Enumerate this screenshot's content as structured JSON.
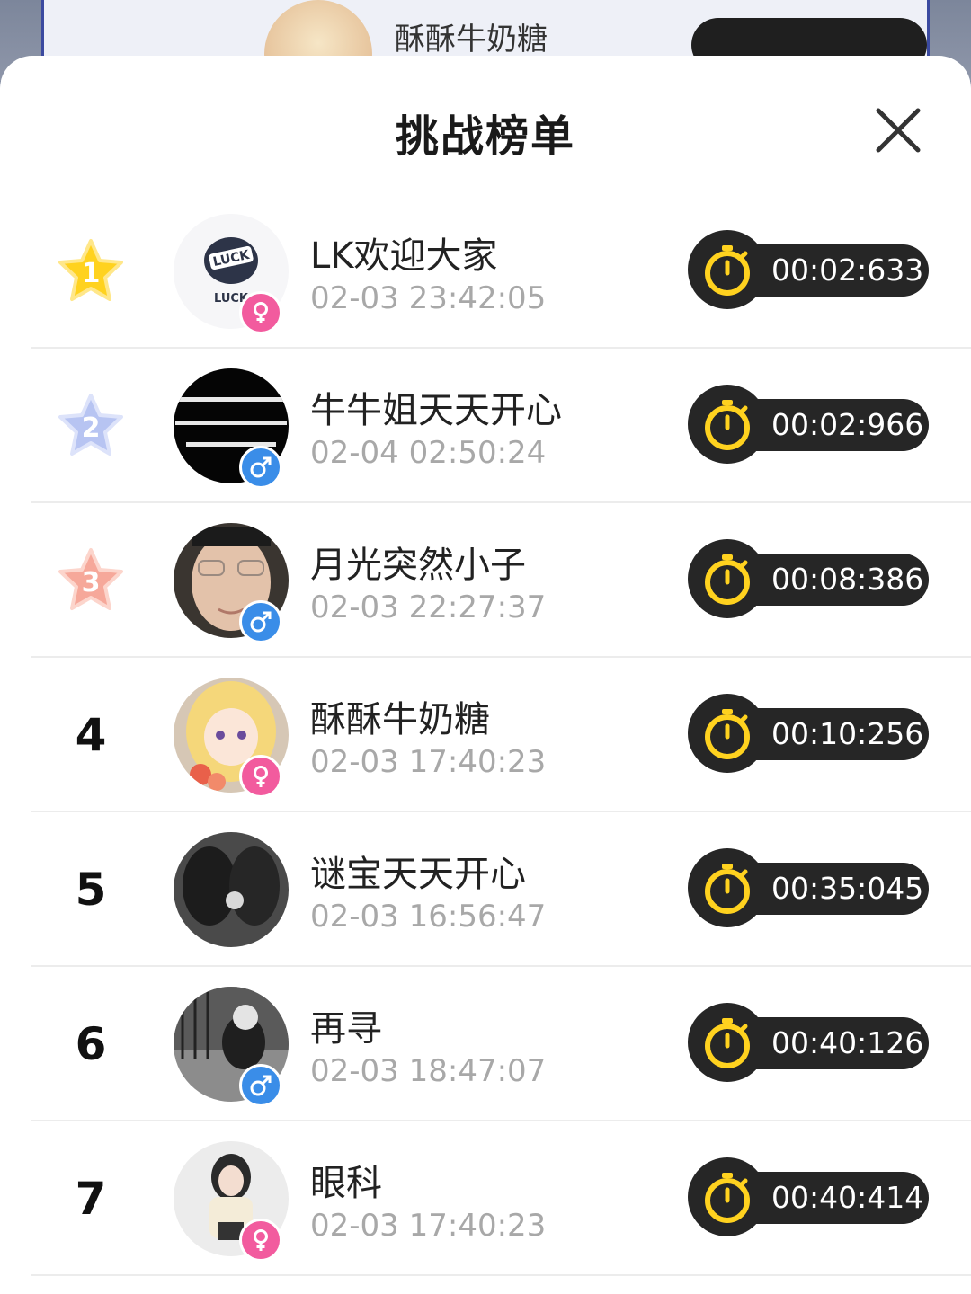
{
  "background": {
    "peek_name": "酥酥牛奶糖"
  },
  "sheet": {
    "title": "挑战榜单",
    "close_icon": "close-icon"
  },
  "rows": [
    {
      "rank": "1",
      "badge": "gold",
      "name": "LK欢迎大家",
      "time": "02-03 23:42:05",
      "duration": "00:02:633",
      "gender": "female",
      "avatar": "avatar-luck-logo"
    },
    {
      "rank": "2",
      "badge": "silver",
      "name": "牛牛姐天天开心",
      "time": "02-04 02:50:24",
      "duration": "00:02:966",
      "gender": "male",
      "avatar": "avatar-text-image"
    },
    {
      "rank": "3",
      "badge": "bronze",
      "name": "月光突然小子",
      "time": "02-03 22:27:37",
      "duration": "00:08:386",
      "gender": "male",
      "avatar": "avatar-face"
    },
    {
      "rank": "4",
      "badge": "none",
      "name": "酥酥牛奶糖",
      "time": "02-03 17:40:23",
      "duration": "00:10:256",
      "gender": "female",
      "avatar": "avatar-anime-girl"
    },
    {
      "rank": "5",
      "badge": "none",
      "name": "谜宝天天开心",
      "time": "02-03 16:56:47",
      "duration": "00:35:045",
      "gender": "none",
      "avatar": "avatar-couple-bw"
    },
    {
      "rank": "6",
      "badge": "none",
      "name": "再寻",
      "time": "02-03 18:47:07",
      "duration": "00:40:126",
      "gender": "male",
      "avatar": "avatar-street"
    },
    {
      "rank": "7",
      "badge": "none",
      "name": "眼科",
      "time": "02-03 17:40:23",
      "duration": "00:40:414",
      "gender": "female",
      "avatar": "avatar-girl-photo"
    }
  ],
  "colors": {
    "female": "#f25b9e",
    "male": "#3a8de8",
    "gold": "#ffd21f",
    "silver": "#b7c4f2",
    "bronze": "#f6a89a",
    "pill": "#262626",
    "stopwatch": "#ffd21f",
    "time_text": "#a8a8a8"
  }
}
